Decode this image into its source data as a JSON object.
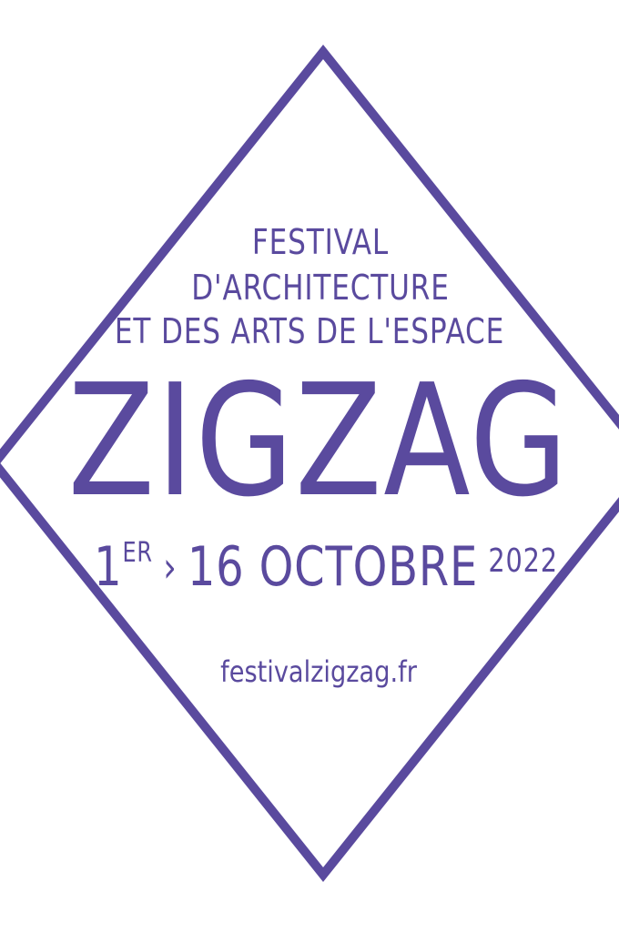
{
  "colors": {
    "brand": "#5a4a9e",
    "background": "#ffffff"
  },
  "poster": {
    "subtitle": [
      "FESTIVAL",
      "D'ARCHITECTURE",
      "ET DES ARTS DE L'ESPACE"
    ],
    "title": "ZIGZAG",
    "dates": {
      "start_day": "1",
      "start_suffix": "ER",
      "separator": "›",
      "end": "16 OCTOBRE",
      "year": "2022"
    },
    "website": "festivalzigzag.fr"
  }
}
